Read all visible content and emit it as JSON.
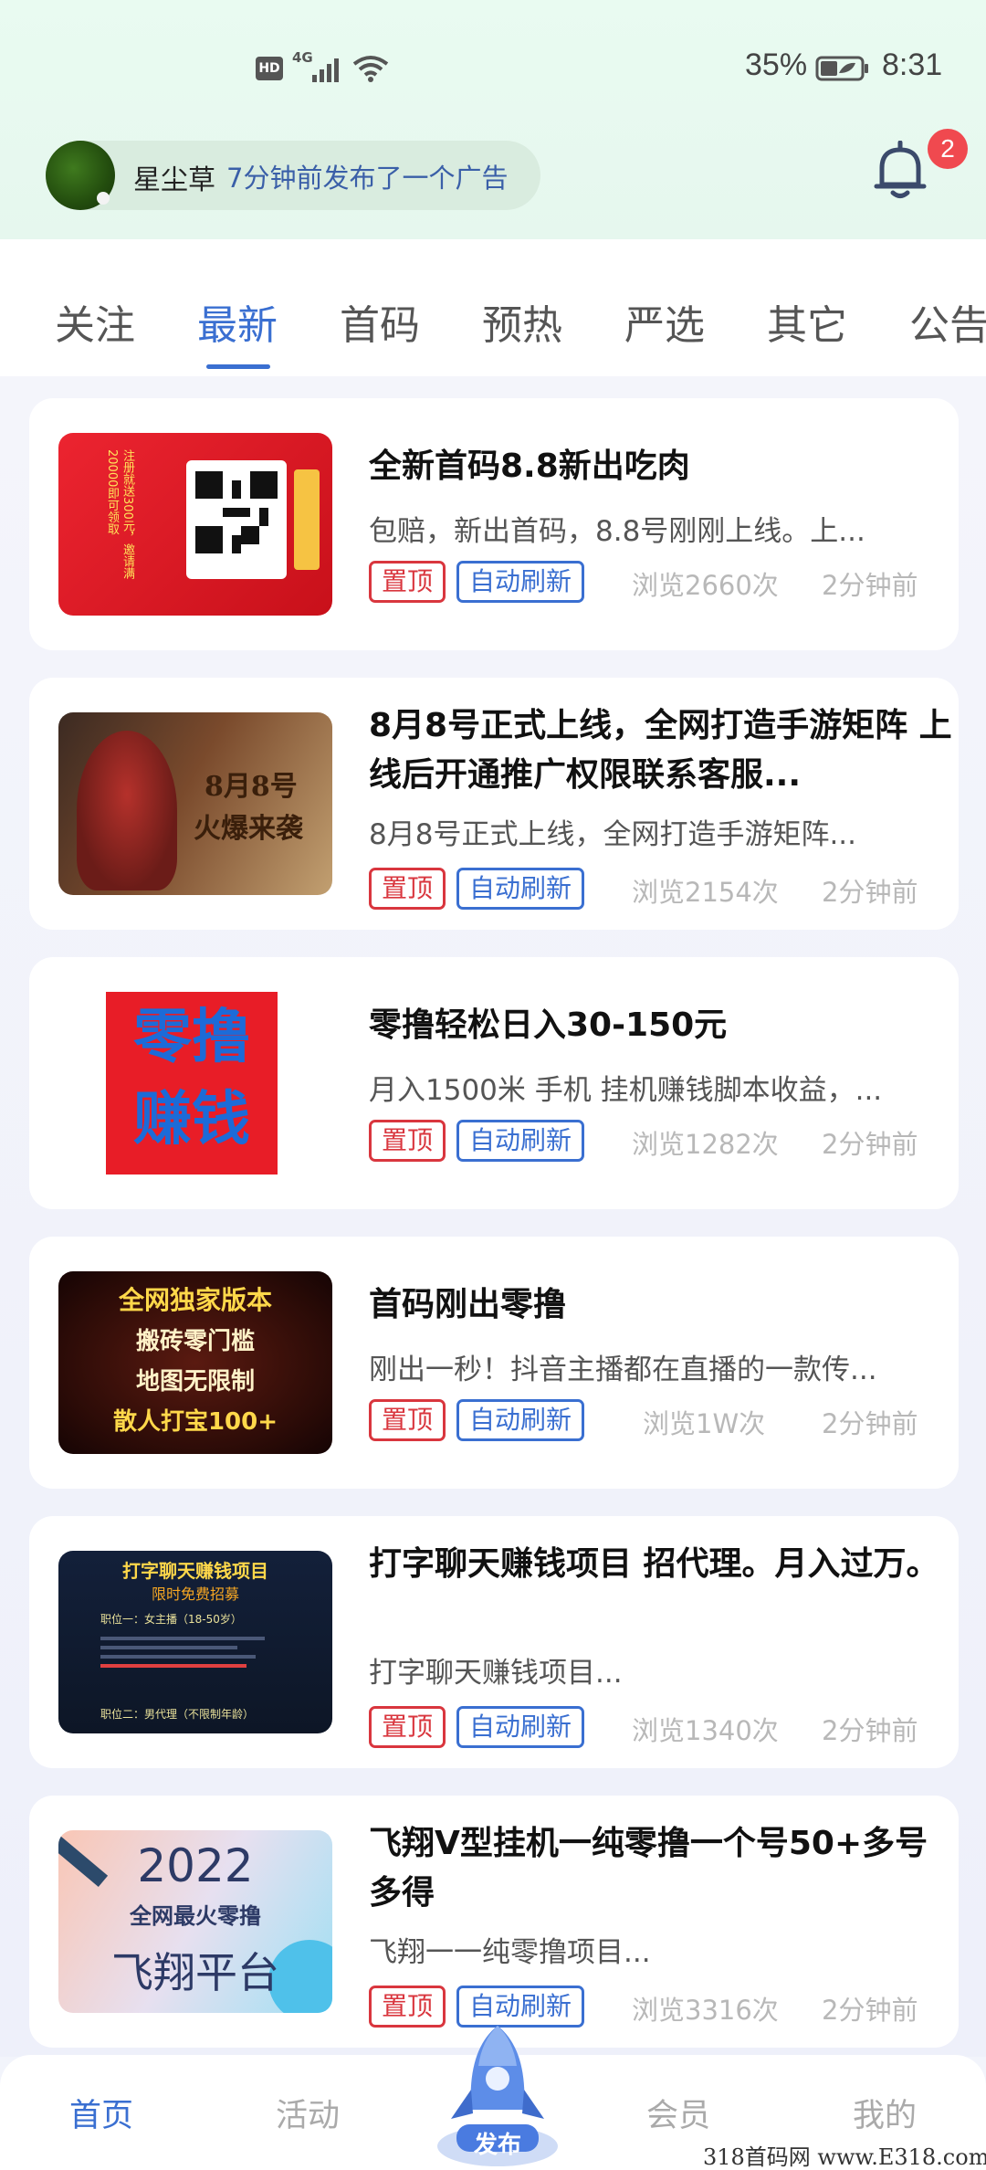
{
  "status_bar": {
    "hd": "HD",
    "network": "4G",
    "battery_pct": "35%",
    "time": "8:31"
  },
  "notification": {
    "user": "星尘草",
    "text": "7分钟前发布了一个广告",
    "badge_count": "2"
  },
  "tabs": [
    {
      "label": "关注"
    },
    {
      "label": "最新"
    },
    {
      "label": "首码"
    },
    {
      "label": "预热"
    },
    {
      "label": "严选"
    },
    {
      "label": "其它"
    },
    {
      "label": "公告"
    }
  ],
  "active_tab": "最新",
  "posts": [
    {
      "title": "全新首码8.8新出吃肉",
      "desc": "包赔，新出首码，8.8号刚刚上线。上...",
      "tag_top": "置顶",
      "tag_refresh": "自动刷新",
      "views": "浏览2660次",
      "time": "2分钟前",
      "thumb_text": "注册就送300元，邀请满20000即可领取",
      "thumb_colors": [
        "#e61e2a",
        "#c40e18"
      ]
    },
    {
      "title": "8月8号正式上线，全网打造手游矩阵 上线后开通推广权限联系客服...",
      "desc": "8月8号正式上线，全网打造手游矩阵...",
      "tag_top": "置顶",
      "tag_refresh": "自动刷新",
      "views": "浏览2154次",
      "time": "2分钟前",
      "thumb_line1": "8月8号",
      "thumb_line2": "火爆来袭"
    },
    {
      "title": "零撸轻松日入30-150元",
      "desc": "月入1500米 手机 挂机赚钱脚本收益，...",
      "tag_top": "置顶",
      "tag_refresh": "自动刷新",
      "views": "浏览1282次",
      "time": "2分钟前",
      "thumb_line1": "零撸",
      "thumb_line2": "赚钱"
    },
    {
      "title": "首码刚出零撸",
      "desc": "刚出一秒！抖音主播都在直播的一款传...",
      "tag_top": "置顶",
      "tag_refresh": "自动刷新",
      "views": "浏览1W次",
      "time": "2分钟前",
      "thumb_line1": "全网独家版本",
      "thumb_line2": "搬砖零门槛",
      "thumb_line3": "地图无限制",
      "thumb_line4": "散人打宝100+"
    },
    {
      "title": "打字聊天赚钱项目 招代理。月入过万。",
      "desc": "打字聊天赚钱项目...",
      "tag_top": "置顶",
      "tag_refresh": "自动刷新",
      "views": "浏览1340次",
      "time": "2分钟前",
      "thumb_line1": "打字聊天赚钱项目",
      "thumb_line2": "限时免费招募",
      "thumb_line3": "职位一：女主播（18-50岁）",
      "thumb_line4": "职位二：男代理（不限制年龄）"
    },
    {
      "title": "飞翔V型挂机一纯零撸一个号50+多号多得",
      "desc": "飞翔一一纯零撸项目...",
      "tag_top": "置顶",
      "tag_refresh": "自动刷新",
      "views": "浏览3316次",
      "time": "2分钟前",
      "thumb_line1": "2022",
      "thumb_line2": "全网最火零撸",
      "thumb_line3": "飞翔平台"
    }
  ],
  "bottom_nav": [
    {
      "label": "首页"
    },
    {
      "label": "活动"
    },
    {
      "label": "发布"
    },
    {
      "label": "会员"
    },
    {
      "label": "我的"
    }
  ],
  "watermark": "318首码网 www.E318.com"
}
